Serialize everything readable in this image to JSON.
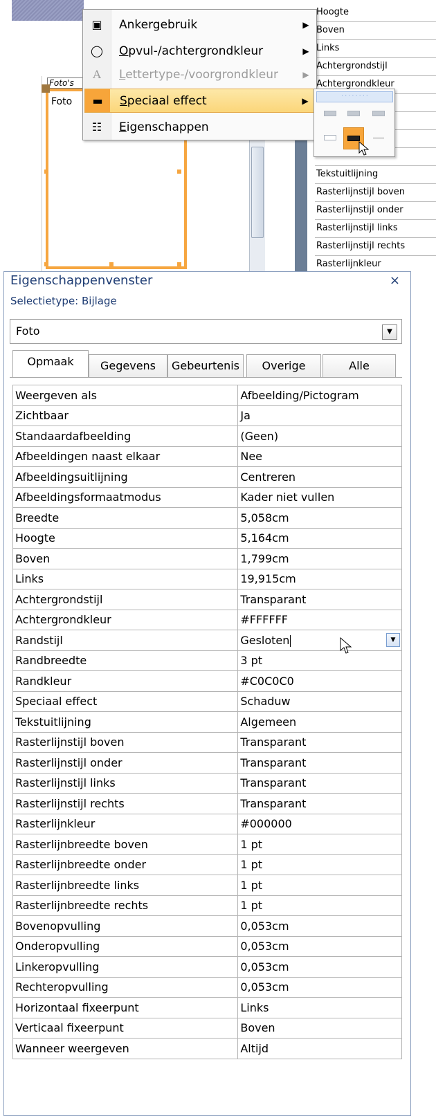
{
  "top_fragment": {
    "form_label": "Foto's",
    "form_field": "Foto",
    "property_list": [
      "Hoogte",
      "Boven",
      "Links",
      "Achtergrondstijl",
      "Achtergrondkleur",
      "",
      "",
      "",
      "",
      "Tekstuitlijning",
      "Rasterlijnstijl boven",
      "Rasterlijnstijl onder",
      "Rasterlijnstijl links",
      "Rasterlijnstijl rechts",
      "Rasterlijnkleur"
    ]
  },
  "context_menu": {
    "items": [
      {
        "label": "Ankergebruik",
        "icon": "anchor-layout-icon",
        "submenu": true,
        "disabled": false,
        "highlight": false
      },
      {
        "label": "Opvul-/achtergrondkleur",
        "icon": "fill-bucket-icon",
        "submenu": true,
        "disabled": false,
        "highlight": false
      },
      {
        "label": "Lettertype-/voorgrondkleur",
        "icon": "font-color-icon",
        "submenu": true,
        "disabled": true,
        "highlight": false
      },
      {
        "label": "Speciaal effect",
        "icon": "special-effect-icon",
        "submenu": true,
        "disabled": false,
        "highlight": true
      },
      {
        "label": "Eigenschappen",
        "icon": "properties-icon",
        "submenu": false,
        "disabled": false,
        "highlight": false
      }
    ]
  },
  "special_effect_submenu": {
    "selected": "Schaduw"
  },
  "panel": {
    "title": "Eigenschappenvenster",
    "close": "×",
    "selection_type": "Selectietype: Bijlage",
    "object_select": "Foto",
    "tabs": [
      "Opmaak",
      "Gegevens",
      "Gebeurtenis",
      "Overige",
      "Alle"
    ],
    "active_tab": "Opmaak",
    "properties": [
      {
        "name": "Weergeven als",
        "value": "Afbeelding/Pictogram"
      },
      {
        "name": "Zichtbaar",
        "value": "Ja"
      },
      {
        "name": "Standaardafbeelding",
        "value": "(Geen)"
      },
      {
        "name": "Afbeeldingen naast elkaar",
        "value": "Nee"
      },
      {
        "name": "Afbeeldingsuitlijning",
        "value": "Centreren"
      },
      {
        "name": "Afbeeldingsformaatmodus",
        "value": "Kader niet vullen"
      },
      {
        "name": "Breedte",
        "value": "5,058cm"
      },
      {
        "name": "Hoogte",
        "value": "5,164cm"
      },
      {
        "name": "Boven",
        "value": "1,799cm"
      },
      {
        "name": "Links",
        "value": "19,915cm"
      },
      {
        "name": "Achtergrondstijl",
        "value": "Transparant"
      },
      {
        "name": "Achtergrondkleur",
        "value": "#FFFFFF"
      },
      {
        "name": "Randstijl",
        "value": "Gesloten"
      },
      {
        "name": "Randbreedte",
        "value": "3 pt"
      },
      {
        "name": "Randkleur",
        "value": "#C0C0C0"
      },
      {
        "name": "Speciaal effect",
        "value": "Schaduw"
      },
      {
        "name": "Tekstuitlijning",
        "value": "Algemeen"
      },
      {
        "name": "Rasterlijnstijl boven",
        "value": "Transparant"
      },
      {
        "name": "Rasterlijnstijl onder",
        "value": "Transparant"
      },
      {
        "name": "Rasterlijnstijl links",
        "value": "Transparant"
      },
      {
        "name": "Rasterlijnstijl rechts",
        "value": "Transparant"
      },
      {
        "name": "Rasterlijnkleur",
        "value": "#000000"
      },
      {
        "name": "Rasterlijnbreedte boven",
        "value": "1 pt"
      },
      {
        "name": "Rasterlijnbreedte onder",
        "value": "1 pt"
      },
      {
        "name": "Rasterlijnbreedte links",
        "value": "1 pt"
      },
      {
        "name": "Rasterlijnbreedte rechts",
        "value": "1 pt"
      },
      {
        "name": "Bovenopvulling",
        "value": "0,053cm"
      },
      {
        "name": "Onderopvulling",
        "value": "0,053cm"
      },
      {
        "name": "Linkeropvulling",
        "value": "0,053cm"
      },
      {
        "name": "Rechteropvulling",
        "value": "0,053cm"
      },
      {
        "name": "Horizontaal fixeerpunt",
        "value": "Links"
      },
      {
        "name": "Verticaal fixeerpunt",
        "value": "Boven"
      },
      {
        "name": "Wanneer weergeven",
        "value": "Altijd"
      }
    ],
    "editing_row": "Randstijl"
  },
  "colors": {
    "accent_orange": "#f7a53a",
    "panel_title": "#1f3d74",
    "highlight": "#fbd67a"
  }
}
